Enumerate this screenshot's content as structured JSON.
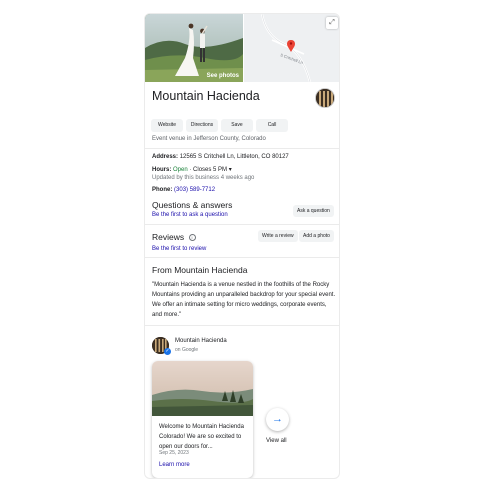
{
  "photo": {
    "overlay_label": "See photos"
  },
  "map": {
    "road_label": "S Critchell Ln",
    "expand_icon": "expand-icon"
  },
  "business": {
    "name": "Mountain Hacienda",
    "category": "Event venue in Jefferson County, Colorado"
  },
  "actions": {
    "website": "Website",
    "directions": "Directions",
    "save": "Save",
    "call": "Call"
  },
  "info": {
    "address_label": "Address:",
    "address_value": "12565 S Critchell Ln, Littleton, CO 80127",
    "hours_label": "Hours:",
    "hours_status": "Open",
    "hours_sep": "·",
    "hours_close": "Closes 5 PM",
    "hours_updated": "Updated by this business 4 weeks ago",
    "phone_label": "Phone:",
    "phone_value": "(303) 589-7712"
  },
  "qa": {
    "heading": "Questions & answers",
    "link": "Be the first to ask a question",
    "ask_button": "Ask a question"
  },
  "reviews": {
    "heading": "Reviews",
    "link": "Be the first to review",
    "write_button": "Write a review",
    "photo_button": "Add a photo"
  },
  "from_business": {
    "heading": "From Mountain Hacienda",
    "quote": "\"Mountain Hacienda is a venue nestled in the foothills of the Rocky Mountains providing an unparalleled backdrop for your special event. We offer an intimate setting for micro weddings, corporate events, and more.\""
  },
  "posts": {
    "author": "Mountain Hacienda",
    "source": "on Google",
    "post_text": "Welcome to Mountain Hacienda Colorado! We are so excited to open our doors for...",
    "post_date": "Sep 25, 2023",
    "learn_more": "Learn more",
    "view_all": "View all"
  },
  "colors": {
    "link": "#1a0dab",
    "open": "#188038",
    "accent": "#1a73e8"
  }
}
